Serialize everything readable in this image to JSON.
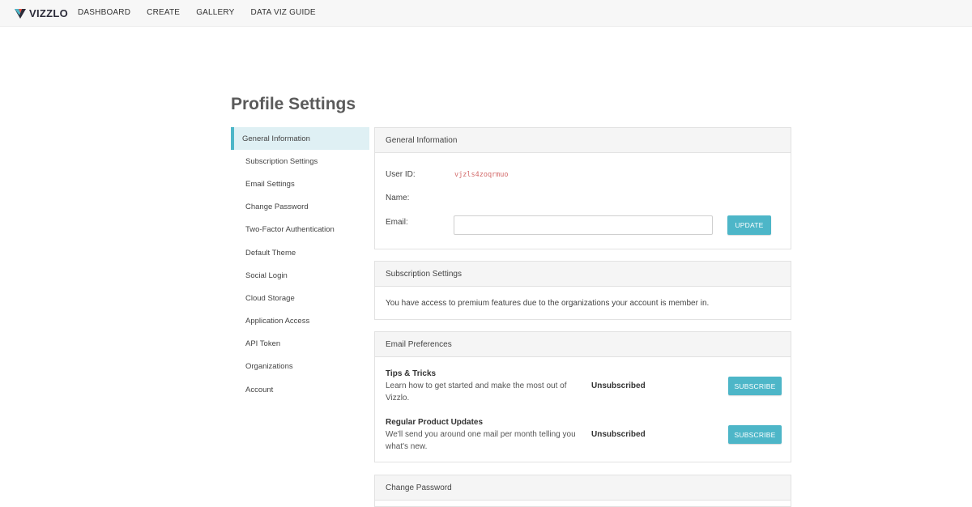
{
  "brand": {
    "name": "VIZZLO"
  },
  "nav": {
    "items": [
      "DASHBOARD",
      "CREATE",
      "GALLERY",
      "DATA VIZ GUIDE"
    ]
  },
  "page": {
    "title": "Profile Settings"
  },
  "sidebar": {
    "items": [
      "General Information",
      "Subscription Settings",
      "Email Settings",
      "Change Password",
      "Two-Factor Authentication",
      "Default Theme",
      "Social Login",
      "Cloud Storage",
      "Application Access",
      "API Token",
      "Organizations",
      "Account"
    ],
    "active_index": 0
  },
  "general": {
    "heading": "General Information",
    "user_id_label": "User ID:",
    "user_id_value": "vjzls4zoqrmuo",
    "name_label": "Name:",
    "email_label": "Email:",
    "email_value": "",
    "email_placeholder": "",
    "update_label": "UPDATE"
  },
  "subscription": {
    "heading": "Subscription Settings",
    "message": "You have access to premium features due to the organizations your account is member in."
  },
  "email_prefs": {
    "heading": "Email Preferences",
    "items": [
      {
        "title": "Tips & Tricks",
        "description": "Learn how to get started and make the most out of Vizzlo.",
        "status": "Unsubscribed",
        "button": "SUBSCRIBE"
      },
      {
        "title": "Regular Product Updates",
        "description": "We'll send you around one mail per month telling you what's new.",
        "status": "Unsubscribed",
        "button": "SUBSCRIBE"
      }
    ]
  },
  "change_password": {
    "heading": "Change Password"
  },
  "colors": {
    "accent": "#4db6c8",
    "active_bg": "#dff0f4",
    "user_id": "#d36a6a"
  }
}
